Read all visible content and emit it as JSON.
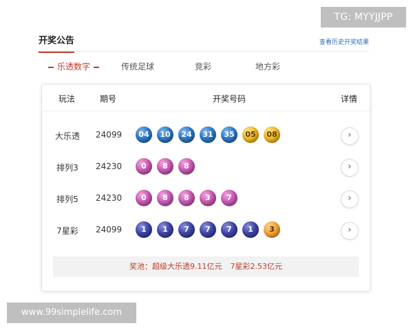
{
  "overlay": {
    "tg": "TG: MYYJJPP",
    "site": "www.99simplelife.com"
  },
  "header": {
    "title": "开奖公告",
    "history_link": "查看历史开奖结果"
  },
  "tabs": [
    {
      "label": "乐透数字",
      "active": true
    },
    {
      "label": "传统足球",
      "active": false
    },
    {
      "label": "竞彩",
      "active": false
    },
    {
      "label": "地方彩",
      "active": false
    }
  ],
  "table": {
    "columns": [
      "玩法",
      "期号",
      "开奖号码",
      "详情"
    ],
    "rows": [
      {
        "name": "大乐透",
        "issue": "24099",
        "balls": [
          {
            "n": "04",
            "color": "blue"
          },
          {
            "n": "10",
            "color": "blue"
          },
          {
            "n": "24",
            "color": "blue"
          },
          {
            "n": "31",
            "color": "blue"
          },
          {
            "n": "35",
            "color": "blue"
          },
          {
            "n": "05",
            "color": "gold"
          },
          {
            "n": "08",
            "color": "gold"
          }
        ]
      },
      {
        "name": "排列3",
        "issue": "24230",
        "balls": [
          {
            "n": "0",
            "color": "pink"
          },
          {
            "n": "8",
            "color": "pink"
          },
          {
            "n": "8",
            "color": "pink"
          }
        ]
      },
      {
        "name": "排列5",
        "issue": "24230",
        "balls": [
          {
            "n": "0",
            "color": "pink"
          },
          {
            "n": "8",
            "color": "pink"
          },
          {
            "n": "8",
            "color": "pink"
          },
          {
            "n": "3",
            "color": "pink"
          },
          {
            "n": "7",
            "color": "pink"
          }
        ]
      },
      {
        "name": "7星彩",
        "issue": "24099",
        "balls": [
          {
            "n": "1",
            "color": "navy"
          },
          {
            "n": "1",
            "color": "navy"
          },
          {
            "n": "7",
            "color": "navy"
          },
          {
            "n": "7",
            "color": "navy"
          },
          {
            "n": "7",
            "color": "navy"
          },
          {
            "n": "1",
            "color": "navy"
          },
          {
            "n": "3",
            "color": "orange"
          }
        ]
      }
    ],
    "detail_icon": "chevron-right-icon",
    "detail_glyph": "›"
  },
  "jackpot": {
    "prefix": "奖池：",
    "item1": "超级大乐透9.11亿元",
    "item2": "7星彩2.53亿元"
  },
  "colors": {
    "accent": "#c0392b",
    "link": "#2f6fb3",
    "ball_blue": "#2f7ac8",
    "ball_gold": "#f0ba26",
    "ball_pink": "#c75bb5",
    "ball_navy": "#3e46a8",
    "ball_orange": "#f3a63a"
  }
}
